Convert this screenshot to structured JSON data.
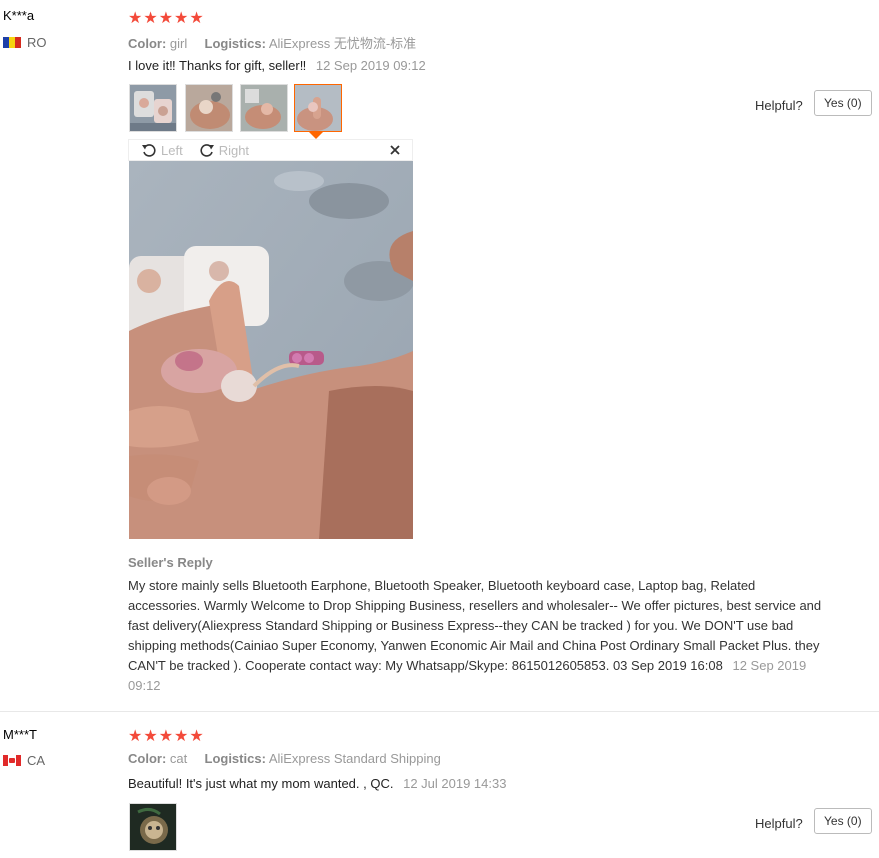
{
  "reviews": [
    {
      "username": "K***a",
      "country": "RO",
      "stars": "★★★★★",
      "color_label": "Color:",
      "color_value": "girl",
      "logistics_label": "Logistics:",
      "logistics_value": "AliExpress 无忧物流-标准",
      "text": "I love it‼ Thanks for gift, seller‼",
      "date": "12 Sep 2019 09:12",
      "helpful_label": "Helpful?",
      "yes_label": "Yes (0)",
      "viewer": {
        "left_label": "Left",
        "right_label": "Right",
        "close_icon": "close-icon"
      },
      "seller_reply_title": "Seller's Reply",
      "seller_reply": "My store mainly sells Bluetooth Earphone, Bluetooth Speaker, Bluetooth keyboard case, Laptop bag, Related accessories. Warmly Welcome to Drop Shipping Business, resellers and wholesaler-- We offer pictures, best service and fast delivery(Aliexpress Standard Shipping or Business Express--they CAN be tracked ) for you. We DON'T use bad shipping methods(Cainiao Super Economy, Yanwen Economic Air Mail and China Post Ordinary Small Packet Plus. they CAN'T be tracked ). Cooperate contact way: My Whatsapp/Skype: 8615012605853. 03 Sep 2019 16:08",
      "seller_reply_date": "12 Sep 2019 09:12"
    },
    {
      "username": "M***T",
      "country": "CA",
      "stars": "★★★★★",
      "color_label": "Color:",
      "color_value": "cat",
      "logistics_label": "Logistics:",
      "logistics_value": "AliExpress Standard Shipping",
      "text": "Beautiful! It's just what my mom wanted. , QC.",
      "date": "12 Jul 2019 14:33",
      "helpful_label": "Helpful?",
      "yes_label": "Yes (0)"
    }
  ],
  "colors": {
    "star": "#f34a3a",
    "active_border": "#ff6600"
  }
}
